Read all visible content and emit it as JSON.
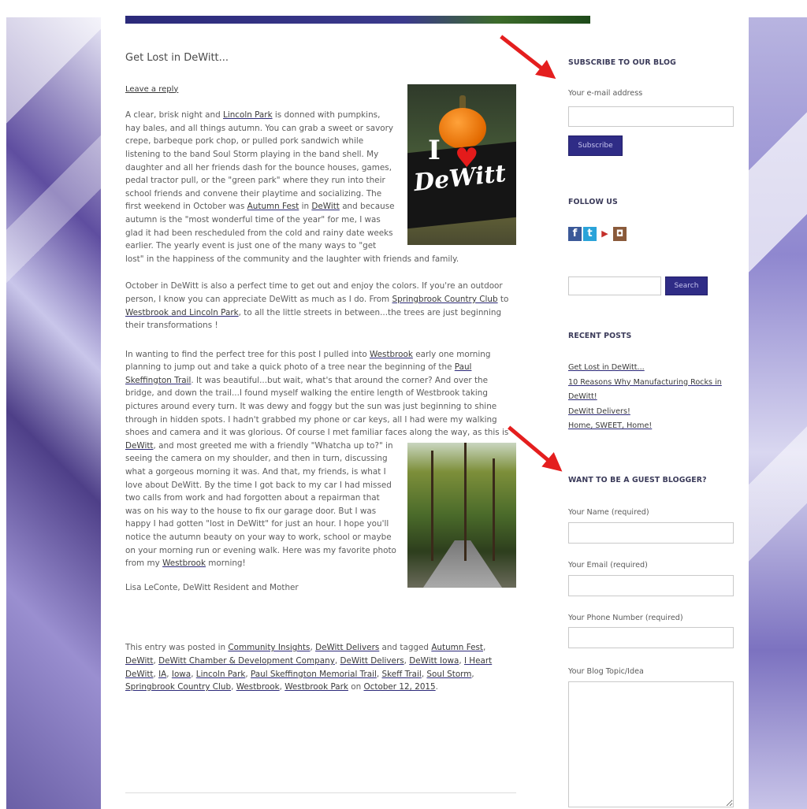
{
  "post": {
    "title": "Get Lost in DeWitt...",
    "leave_reply": "Leave a reply",
    "p1_a": "A clear, brisk night and ",
    "p1_link1": "Lincoln Park",
    "p1_b": " is donned with pumpkins, hay bales, and all things autumn.  You can grab a sweet or savory crepe, barbeque pork chop, or pulled pork sandwich while listening to the band Soul Storm playing in the band shell.  My daughter and all her friends dash for the bounce houses, games, pedal tractor pull, or the \"green park\" where they run into their school friends and convene their playtime and socializing.  The first weekend in October was ",
    "p1_link2": "Autumn Fest",
    "p1_c": " in ",
    "p1_link3": "DeWitt",
    "p1_d": " and because autumn is the \"most wonderful time of the year\" for me, I was glad it had been rescheduled from the cold and rainy date weeks earlier.  The yearly event is just one of the many ways to \"get lost\" in the happiness of the community and the laughter with friends and family.",
    "p2_a": "October in DeWitt is also a perfect time to get out and enjoy the colors.  If you're an outdoor person, I know you can appreciate DeWitt as much as I do.  From ",
    "p2_link1": "Springbrook Country Club",
    "p2_b": " to ",
    "p2_link2": "Westbrook and Lincoln Park",
    "p2_c": ", to all the little streets in between...the trees are just beginning their transformations !",
    "p3_a": "In wanting to find the perfect tree for this post I pulled into ",
    "p3_link1": "Westbrook",
    "p3_b": " early one morning planning to jump out and take a quick photo of a tree near the beginning of the ",
    "p3_link2": "Paul Skeffington Trail",
    "p3_c": ".  It was beautiful...but wait, what's that around the corner?  And over the bridge, and down the trail...I found myself walking the entire length of Westbrook taking pictures around every turn.  It was dewy and foggy but the sun was just beginning to shine through in hidden spots.  I hadn't grabbed my phone or car keys, all I had were my walking shoes and camera and it was glorious.  Of course I met familiar faces along the way, as this is ",
    "p3_link3": "DeWitt",
    "p3_d": ", and most greeted me with a friendly \"Whatcha up to?\" in seeing the camera on my shoulder, and then in turn, discussing what a gorgeous morning it was.  And that, my friends, is what I love about DeWitt.  By the time I got back to my car I had missed two calls from work and had forgotten about a repairman that was on his way to the house to fix our garage door.  But I was happy I had gotten \"lost in DeWitt\" for just an hour.  I hope you'll notice the autumn beauty on your way to work, school or maybe on your morning run or evening walk.  Here was my favorite photo from my ",
    "p3_link4": "Westbrook",
    "p3_e": " morning!",
    "signature": "Lisa LeConte, DeWitt Resident and Mother",
    "image1_text_i": "I",
    "image1_text_dewitt": "DeWitt",
    "meta_prefix": "This entry was posted in ",
    "categories": [
      "Community Insights",
      "DeWitt Delivers"
    ],
    "meta_tagged": " and tagged ",
    "tags": [
      "Autumn Fest",
      "DeWitt",
      "DeWitt Chamber & Development Company",
      "DeWitt Delivers",
      "DeWitt Iowa",
      "I Heart DeWitt",
      "IA",
      "Iowa",
      "Lincoln Park",
      "Paul Skeffington Memorial Trail",
      "Skeff Trail",
      "Soul Storm",
      "Springbrook Country Club",
      "Westbrook",
      "Westbrook Park"
    ],
    "meta_on": " on ",
    "date": "October 12, 2015",
    "meta_end": "."
  },
  "sidebar": {
    "subscribe_title": "SUBSCRIBE TO OUR BLOG",
    "email_label": "Your e-mail address",
    "subscribe_button": "Subscribe",
    "follow_title": "FOLLOW US",
    "social_icons": [
      "facebook-icon",
      "twitter-icon",
      "youtube-icon",
      "instagram-icon"
    ],
    "search_button": "Search",
    "recent_title": "RECENT POSTS",
    "recent_posts": [
      "Get Lost in DeWitt...",
      "10 Reasons Why Manufacturing Rocks in DeWitt!",
      "DeWitt Delivers!",
      "Home, SWEET, Home!"
    ],
    "guest_title": "WANT TO BE A GUEST BLOGGER?",
    "name_label": "Your Name (required)",
    "email2_label": "Your Email (required)",
    "phone_label": "Your Phone Number (required)",
    "topic_label": "Your Blog Topic/Idea"
  },
  "colors": {
    "accent": "#2f2c86",
    "arrow": "#e41e1e"
  }
}
